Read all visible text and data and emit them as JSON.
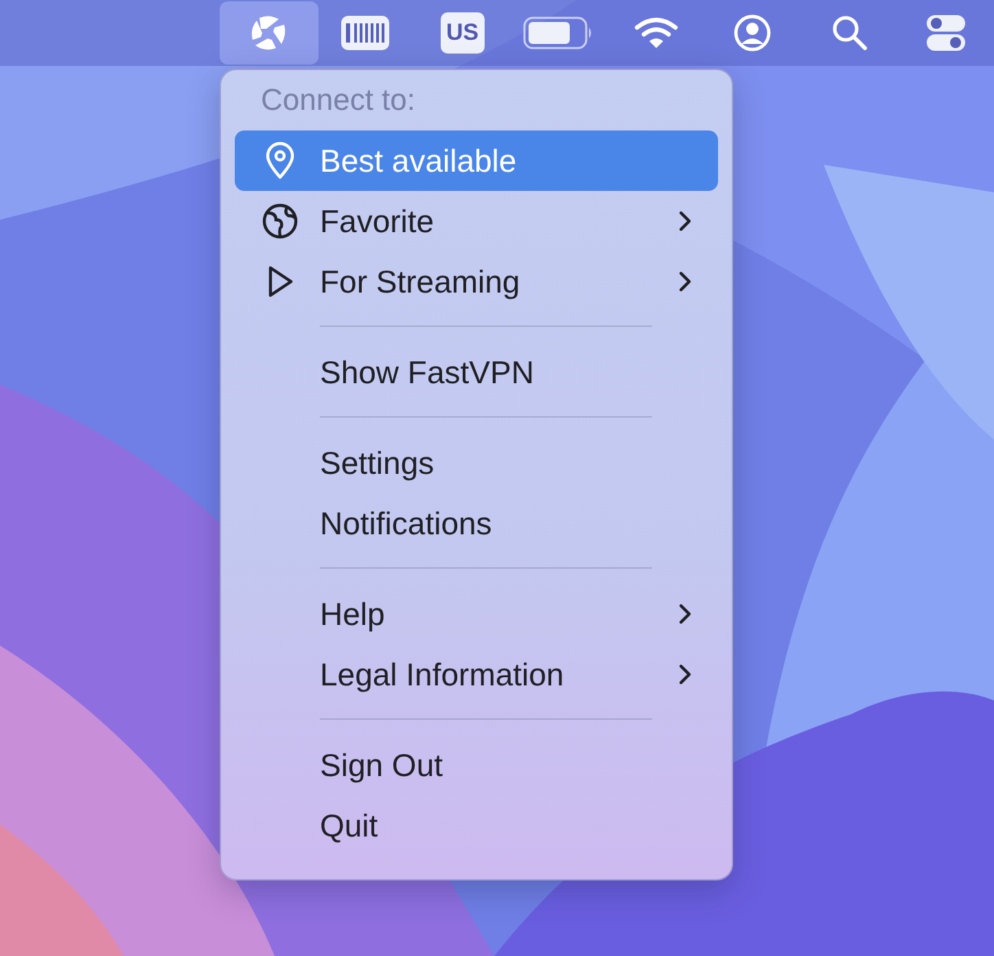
{
  "menubar": {
    "items": [
      {
        "kind": "app",
        "selected": true
      },
      {
        "kind": "keyboard",
        "selected": false
      },
      {
        "kind": "input_source",
        "label": "US",
        "selected": false
      },
      {
        "kind": "battery",
        "selected": false
      },
      {
        "kind": "wifi",
        "selected": false
      },
      {
        "kind": "user",
        "selected": false
      },
      {
        "kind": "search",
        "selected": false
      },
      {
        "kind": "control",
        "selected": false
      }
    ]
  },
  "menu": {
    "header": "Connect to:",
    "items": [
      {
        "kind": "location",
        "label": "Best available",
        "selected": true,
        "submenu": false
      },
      {
        "kind": "favorite",
        "label": "Favorite",
        "selected": false,
        "submenu": true
      },
      {
        "kind": "streaming",
        "label": "For Streaming",
        "selected": false,
        "submenu": true
      },
      {
        "kind": "separator"
      },
      {
        "kind": "plain",
        "label": "Show FastVPN",
        "selected": false,
        "submenu": false
      },
      {
        "kind": "separator"
      },
      {
        "kind": "plain",
        "label": "Settings",
        "selected": false,
        "submenu": false
      },
      {
        "kind": "plain",
        "label": "Notifications",
        "selected": false,
        "submenu": false
      },
      {
        "kind": "separator"
      },
      {
        "kind": "plain",
        "label": "Help",
        "selected": false,
        "submenu": true
      },
      {
        "kind": "plain",
        "label": "Legal Information",
        "selected": false,
        "submenu": true
      },
      {
        "kind": "separator"
      },
      {
        "kind": "plain",
        "label": "Sign Out",
        "selected": false,
        "submenu": false
      },
      {
        "kind": "plain",
        "label": "Quit",
        "selected": false,
        "submenu": false
      }
    ]
  }
}
